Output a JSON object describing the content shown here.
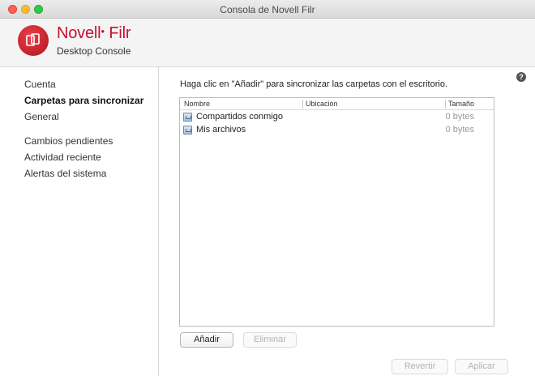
{
  "window": {
    "title": "Consola de Novell Filr"
  },
  "header": {
    "brand": "Novell",
    "product": "Filr",
    "subtitle": "Desktop Console"
  },
  "sidebar": {
    "items": [
      {
        "label": "Cuenta",
        "selected": false
      },
      {
        "label": "Carpetas para sincronizar",
        "selected": true
      },
      {
        "label": "General",
        "selected": false
      },
      {
        "label": "Cambios pendientes",
        "selected": false
      },
      {
        "label": "Actividad reciente",
        "selected": false
      },
      {
        "label": "Alertas del sistema",
        "selected": false
      }
    ]
  },
  "main": {
    "instructions": "Haga clic en \"Añadir\" para sincronizar las carpetas con el escritorio.",
    "table": {
      "columns": [
        "Nombre",
        "Ubicación",
        "Tamaño"
      ],
      "rows": [
        {
          "name": "Compartidos conmigo",
          "location": "",
          "size": "0 bytes",
          "icon": "shared-folder-icon"
        },
        {
          "name": "Mis archivos",
          "location": "",
          "size": "0 bytes",
          "icon": "my-files-folder-icon"
        }
      ]
    },
    "buttons": {
      "add": "Añadir",
      "remove": "Eliminar",
      "revert": "Revertir",
      "apply": "Aplicar"
    }
  },
  "icons": {
    "help": "?",
    "logo": "novell-filr-logo-icon"
  },
  "colors": {
    "brand_red": "#c8102e",
    "selected_text": "#111111"
  }
}
